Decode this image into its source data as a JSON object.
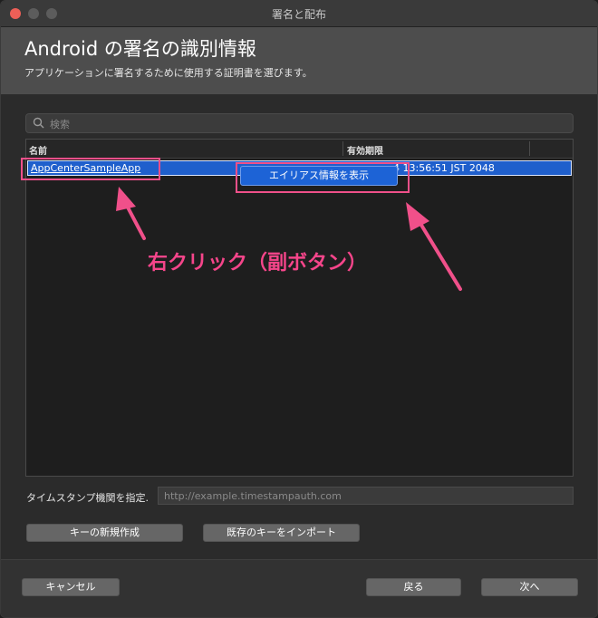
{
  "window": {
    "title": "署名と配布"
  },
  "header": {
    "title": "Android の署名の識別情報",
    "subtitle": "アプリケーションに署名するために使用する証明書を選びます。"
  },
  "search": {
    "placeholder": "検索",
    "value": ""
  },
  "table": {
    "columns": [
      "名前",
      "有効期限"
    ],
    "rows": [
      {
        "name": "AppCenterSampleApp",
        "expiry_visible": "4 13:56:51 JST 2048",
        "selected": true
      }
    ]
  },
  "context_menu": {
    "item_label": "エイリアス情報を表示"
  },
  "annotation": {
    "text": "右クリック（副ボタン）",
    "color": "#f5458a"
  },
  "timestamp": {
    "label": "タイムスタンプ機関を指定.",
    "placeholder": "http://example.timestampauth.com",
    "value": ""
  },
  "actions": {
    "new_key": "キーの新規作成",
    "import_key": "既存のキーをインポート"
  },
  "footer": {
    "cancel": "キャンセル",
    "back": "戻る",
    "next": "次へ"
  },
  "colors": {
    "selection": "#1f5fcc",
    "highlight_box": "#f0508a",
    "close_button": "#ec5f57"
  },
  "icons": {
    "search": "search-icon"
  }
}
